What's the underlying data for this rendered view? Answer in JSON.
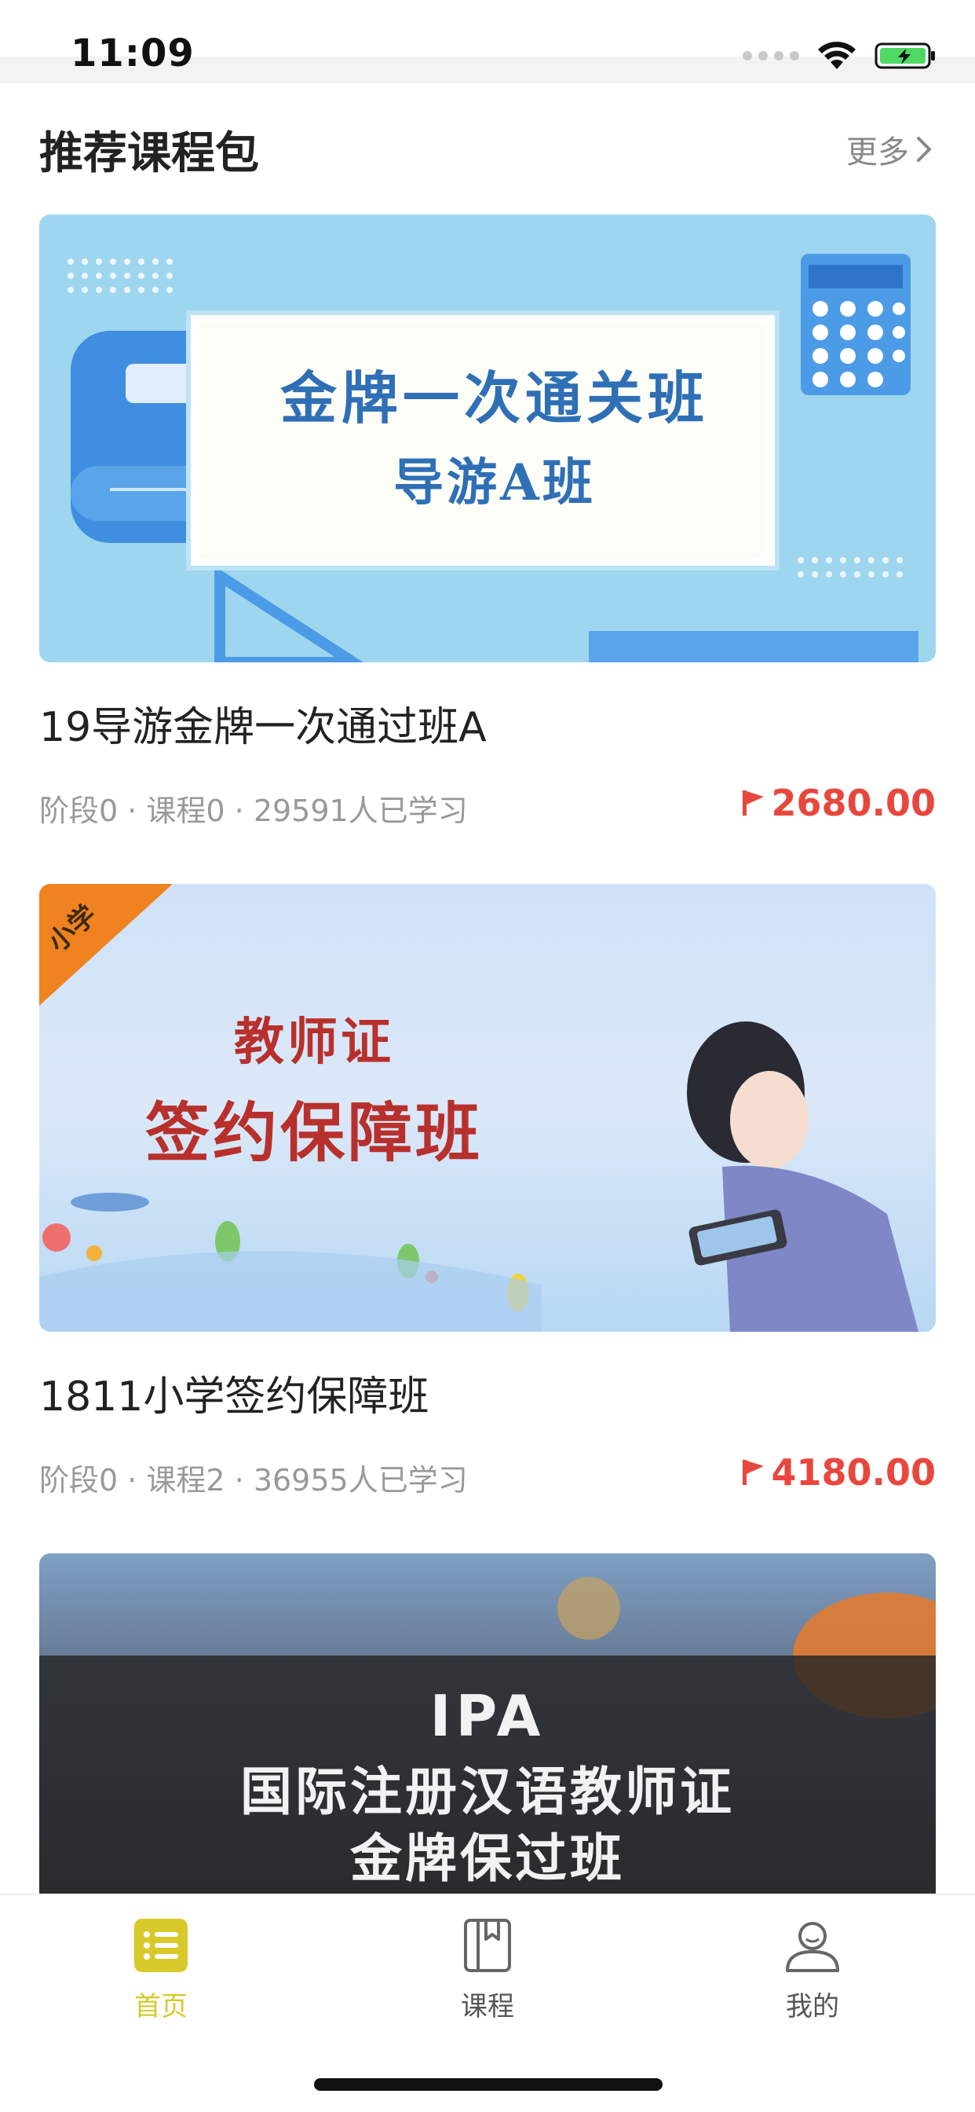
{
  "status_bar": {
    "time": "11:09"
  },
  "section": {
    "title": "推荐课程包",
    "more_label": "更多"
  },
  "courses": [
    {
      "banner_line1": "金牌一次通关班",
      "banner_line2": "导游A班",
      "title": "19导游金牌一次通过班A",
      "meta": "阶段0 · 课程0 · 29591人已学习",
      "price": "2680.00"
    },
    {
      "banner_corner": "小学",
      "banner_line1": "教师证",
      "banner_line2": "签约保障班",
      "title": "1811小学签约保障班",
      "meta": "阶段0 · 课程2 · 36955人已学习",
      "price": "4180.00"
    },
    {
      "banner_line1": "IPA",
      "banner_line2": "国际注册汉语教师证",
      "banner_line3": "金牌保过班"
    }
  ],
  "tabs": [
    {
      "label": "首页",
      "icon": "home-list-icon",
      "active": true
    },
    {
      "label": "课程",
      "icon": "book-icon",
      "active": false
    },
    {
      "label": "我的",
      "icon": "user-icon",
      "active": false
    }
  ],
  "colors": {
    "accent": "#d8c92a",
    "price": "#e8473e",
    "muted": "#999999"
  }
}
